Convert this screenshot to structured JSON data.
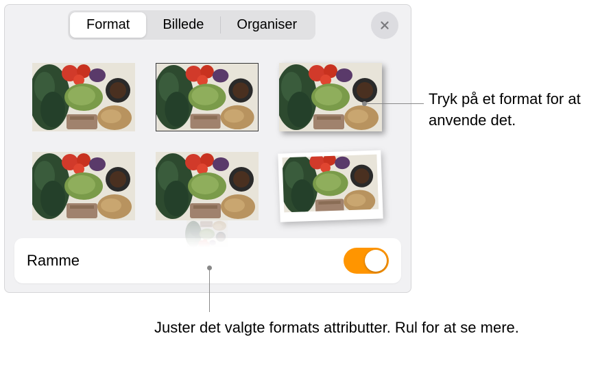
{
  "tabs": {
    "format": "Format",
    "billede": "Billede",
    "organiser": "Organiser",
    "active": "format"
  },
  "ramme": {
    "label": "Ramme",
    "enabled": true
  },
  "callouts": {
    "top": "Tryk på et format for at anvende det.",
    "bottom": "Juster det valgte formats attributter. Rul for at se mere."
  },
  "styles": {
    "items": [
      {
        "id": "plain"
      },
      {
        "id": "thin-border"
      },
      {
        "id": "shadow"
      },
      {
        "id": "plain-2"
      },
      {
        "id": "reflection"
      },
      {
        "id": "polaroid"
      }
    ]
  }
}
